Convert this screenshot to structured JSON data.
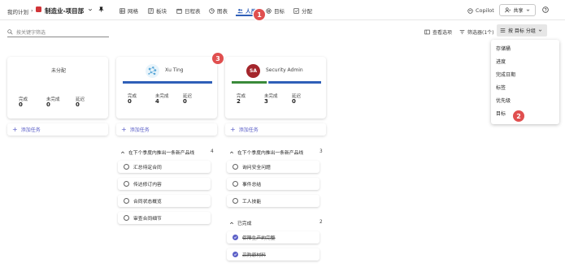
{
  "header": {
    "my_plans": "我的计划",
    "separator": "›",
    "plan_name": "制造业-项目部",
    "tabs": [
      {
        "label": "网格",
        "icon": "grid-icon"
      },
      {
        "label": "板块",
        "icon": "board-icon"
      },
      {
        "label": "日程表",
        "icon": "calendar-icon"
      },
      {
        "label": "图表",
        "icon": "chart-icon"
      },
      {
        "label": "人员",
        "icon": "people-icon"
      },
      {
        "label": "目标",
        "icon": "goal-icon"
      },
      {
        "label": "分配",
        "icon": "assign-icon"
      }
    ],
    "copilot": "Copilot",
    "share": "共享"
  },
  "toolbar": {
    "search_placeholder": "按关键字筛选",
    "view_options": "查看选项",
    "filter": "筛选器(1个)",
    "group_by": "按 目标 分组"
  },
  "group_menu": {
    "items": [
      "存储桶",
      "进度",
      "完成日期",
      "标签",
      "优先级",
      "目标"
    ]
  },
  "columns": [
    {
      "name": "未分配",
      "stats": [
        {
          "label": "完成",
          "value": "0"
        },
        {
          "label": "未完成",
          "value": "0"
        },
        {
          "label": "延迟",
          "value": "0"
        }
      ],
      "add_task": "添加任务"
    },
    {
      "name": "Xu Ting",
      "stats": [
        {
          "label": "完成",
          "value": "0"
        },
        {
          "label": "未完成",
          "value": "4"
        },
        {
          "label": "延迟",
          "value": "0"
        }
      ],
      "add_task": "添加任务",
      "progress": {
        "complete": 0,
        "remaining": 4
      },
      "section": {
        "title": "在下个季度内推出一条新产品线",
        "count": "4"
      },
      "tasks": [
        "汇总待定合同",
        "传达修订内容",
        "合同状态概览",
        "审查合同细节"
      ]
    },
    {
      "name": "Security Admin",
      "initials": "SA",
      "stats": [
        {
          "label": "完成",
          "value": "2"
        },
        {
          "label": "未完成",
          "value": "3"
        },
        {
          "label": "延迟",
          "value": "0"
        }
      ],
      "add_task": "添加任务",
      "progress": {
        "complete": 2,
        "remaining": 3
      },
      "section": {
        "title": "在下个季度内推出一条新产品线",
        "count": "3"
      },
      "tasks": [
        "询问安全问题",
        "事件总结",
        "工人技能"
      ],
      "done_section": {
        "title": "已完成",
        "count": "2"
      },
      "done_tasks": [
        "保障生产的完整",
        "采购原材料"
      ]
    }
  ],
  "callouts": [
    "1",
    "2",
    "3"
  ],
  "colors": {
    "accent": "#2f5fb8",
    "complete": "#3a8a3a",
    "badge": "#e04f4f",
    "plan_logo": "#d13438",
    "avatar_sa": "#a4262c"
  }
}
